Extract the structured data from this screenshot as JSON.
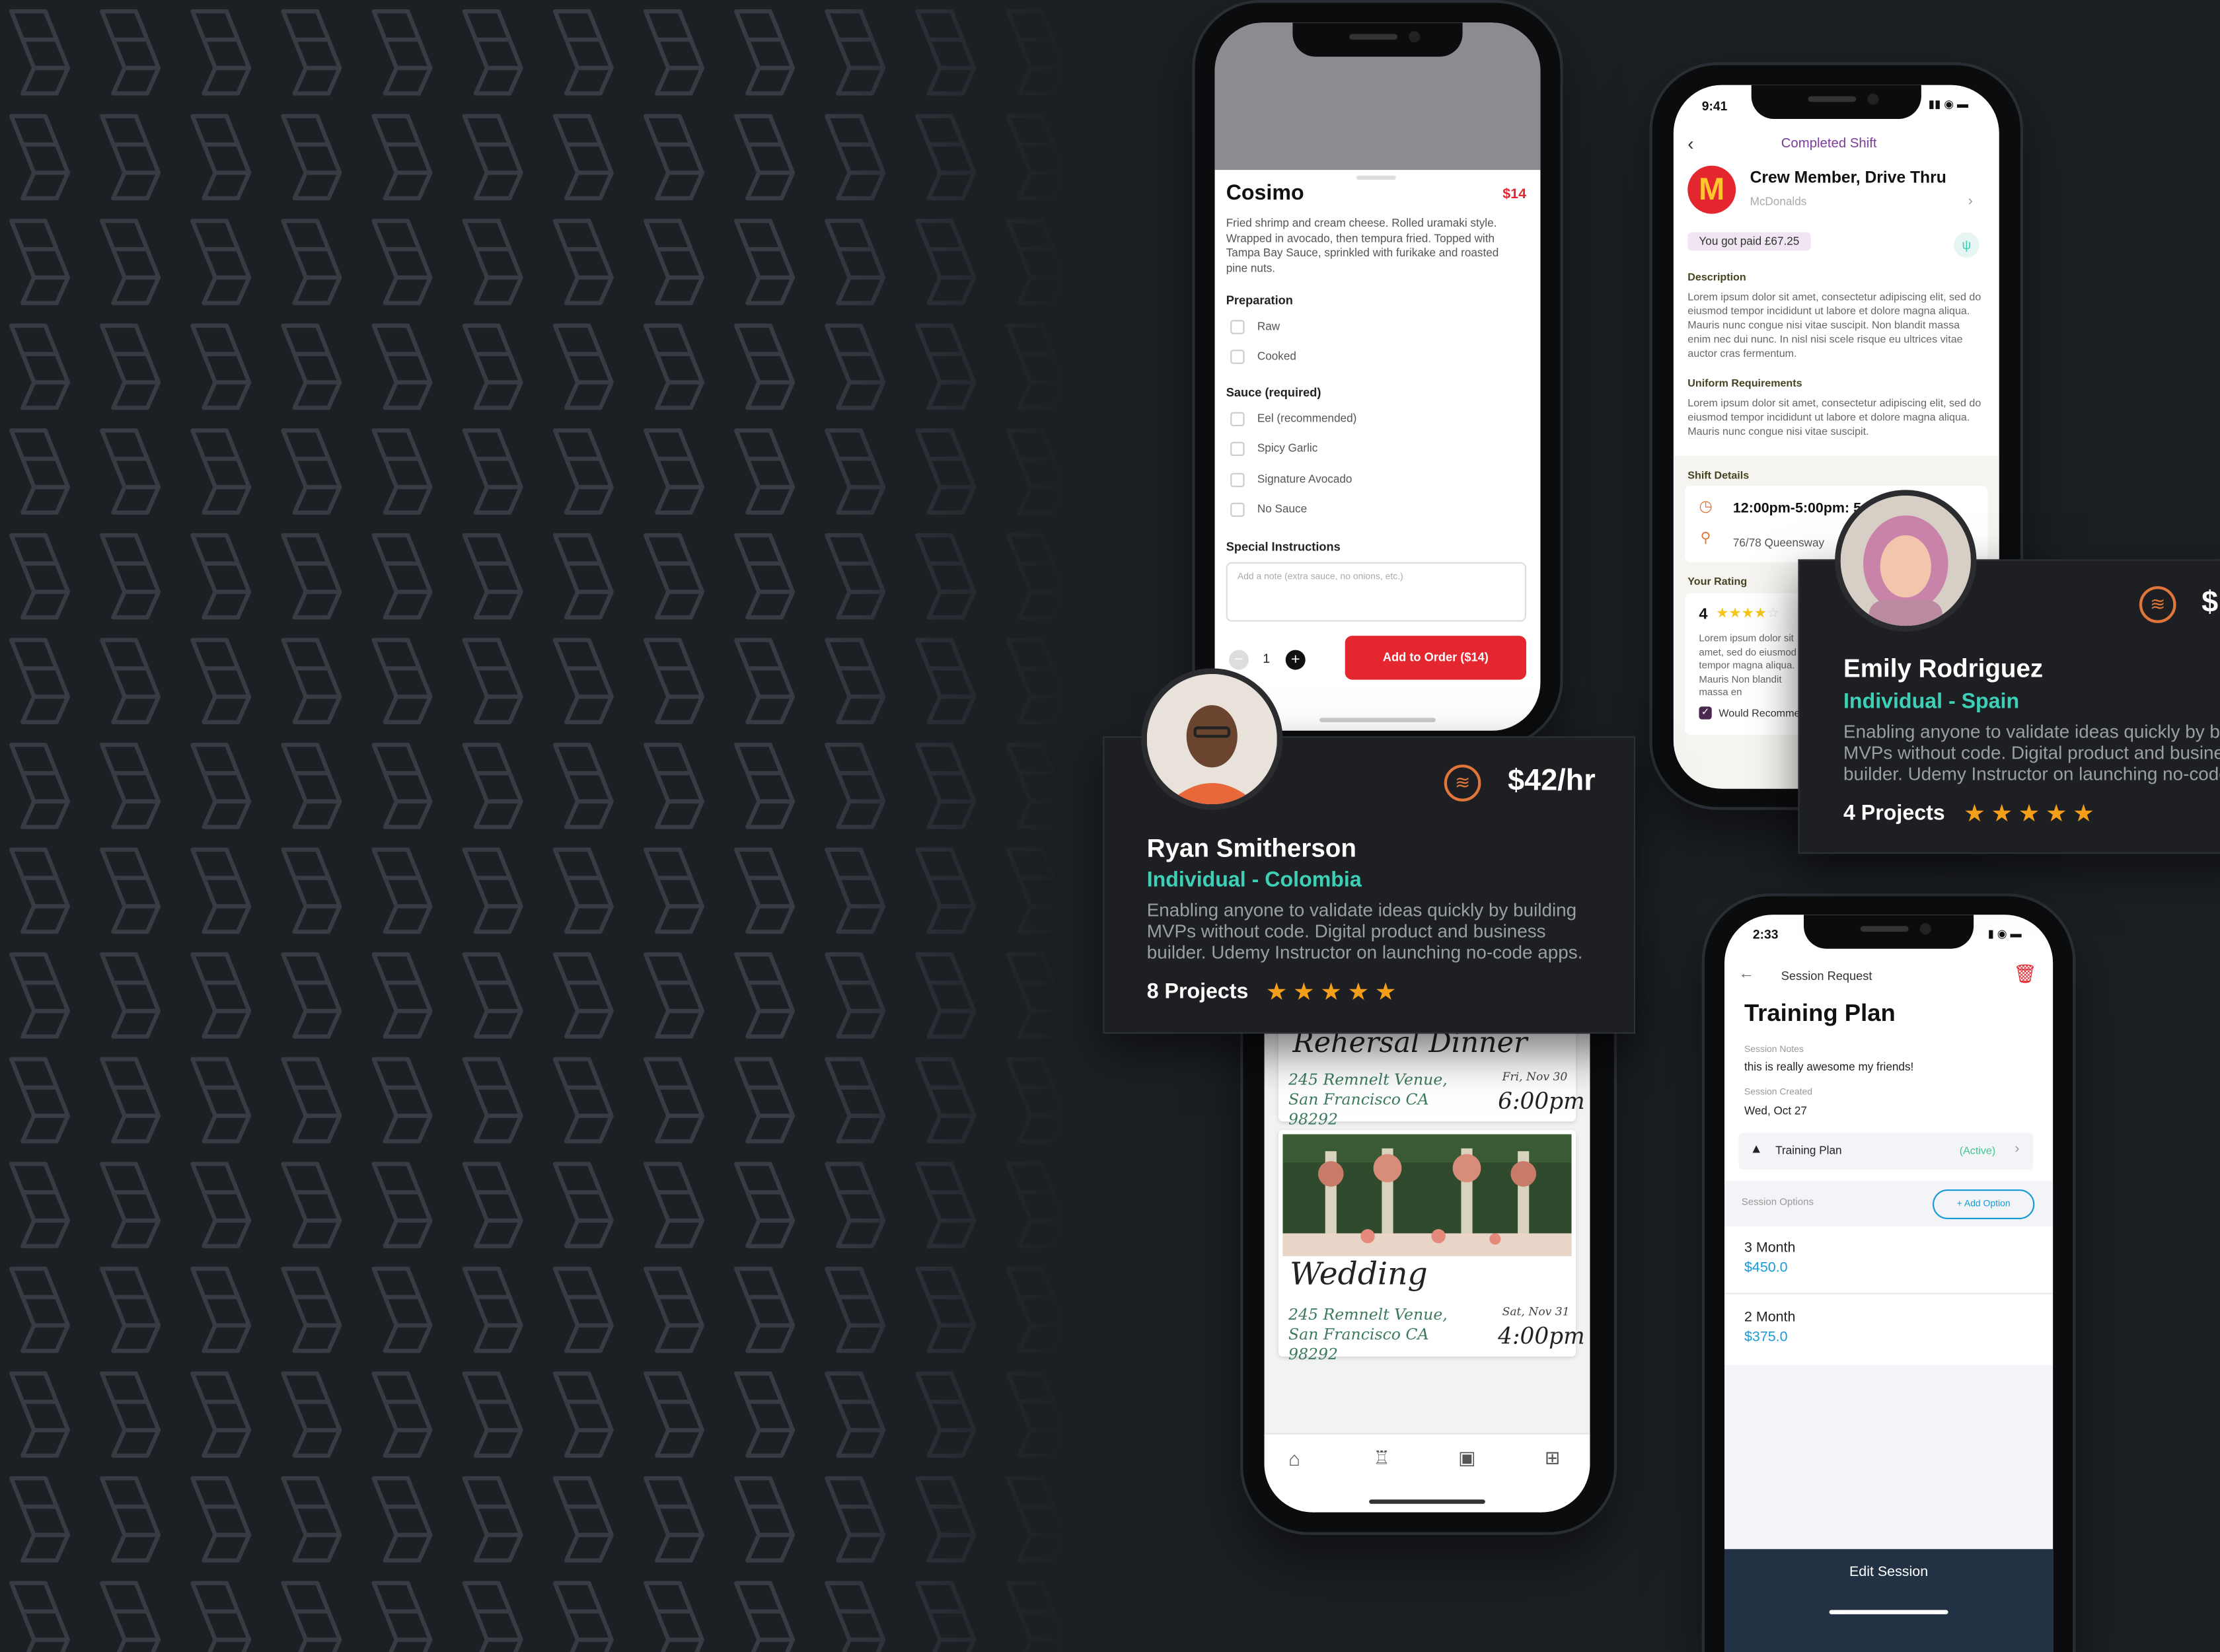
{
  "colors": {
    "background": "#1c1f24",
    "pattern": "#373b42",
    "accent_red": "#e4262f",
    "teal": "#3ecfb7",
    "purple": "#7b3c9c",
    "star": "#f59e1a",
    "navy": "#223244",
    "link_blue": "#1a9ad6"
  },
  "menu_item": {
    "title": "Cosimo",
    "price": "$14",
    "description": "Fried shrimp and cream cheese. Rolled uramaki style. Wrapped in avocado, then tempura fried. Topped with Tampa Bay Sauce, sprinkled with furikake and roasted pine nuts.",
    "preparation_label": "Preparation",
    "preparation_options": [
      "Raw",
      "Cooked"
    ],
    "sauce_label": "Sauce (required)",
    "sauce_options": [
      "Eel (recommended)",
      "Spicy Garlic",
      "Signature Avocado",
      "No Sauce"
    ],
    "special_label": "Special Instructions",
    "special_placeholder": "Add a note (extra sauce, no onions, etc.)",
    "quantity": "1",
    "add_button": "Add to Order ($14)"
  },
  "shift": {
    "time": "9:41",
    "header": "Completed Shift",
    "role": "Crew Member, Drive Thru",
    "company": "McDonalds",
    "paid": "You got paid £67.25",
    "desc_label": "Description",
    "desc_text": "Lorem ipsum dolor sit amet, consectetur adipiscing elit, sed do eiusmod tempor incididunt ut labore et dolore magna aliqua. Mauris nunc congue nisi vitae suscipit. Non blandit massa enim nec dui nunc. In nisl nisi scele risque eu ultrices vitae auctor cras fermentum.",
    "uniform_label": "Uniform Requirements",
    "uniform_text": "Lorem ipsum dolor sit amet, consectetur adipiscing elit, sed do eiusmod tempor incididunt ut labore et dolore magna aliqua. Mauris nunc congue nisi vitae suscipit.",
    "details_label": "Shift Details",
    "hours": "12:00pm-5:00pm: 5",
    "address": "76/78 Queensway",
    "rating_label": "Your Rating",
    "rating": "4",
    "rating_stars": 4,
    "review": "Lorem ipsum dolor sit amet, sed do eiusmod tempor magna aliqua. Mauris Non blandit massa en",
    "recommend": "Would Recommend"
  },
  "events": {
    "items": [
      {
        "title": "Rehersal Dinner",
        "address": "245 Remnelt Venue, San Francisco CA 98292",
        "date": "Fri, Nov 30",
        "time": "6:00pm"
      },
      {
        "title": "Wedding",
        "address": "245 Remnelt Venue, San Francisco CA 98292",
        "date": "Sat, Nov 31",
        "time": "4:00pm"
      }
    ],
    "nav": [
      "home-icon",
      "toast-icon",
      "calendar-icon",
      "grid-icon"
    ]
  },
  "session": {
    "time": "2:33",
    "header": "Session Request",
    "title": "Training Plan",
    "notes_label": "Session Notes",
    "notes": "this is really awesome my friends!",
    "created_label": "Session Created",
    "created": "Wed, Oct 27",
    "plan_name": "Training Plan",
    "plan_status": "(Active)",
    "options_label": "Session Options",
    "add_option": "+ Add Option",
    "options": [
      {
        "name": "3 Month",
        "price": "$450.0"
      },
      {
        "name": "2 Month",
        "price": "$375.0"
      }
    ],
    "footer_button": "Edit Session"
  },
  "profiles": [
    {
      "name": "Ryan Smitherson",
      "subtitle": "Individual - Colombia",
      "rate": "$42/hr",
      "bio": "Enabling anyone to validate ideas quickly by building MVPs without code. Digital product and business builder. Udemy Instructor on launching no-code apps.",
      "projects": "8 Projects",
      "stars": 5
    },
    {
      "name": "Emily Rodriguez",
      "subtitle": "Individual - Spain",
      "rate": "$",
      "bio": "Enabling anyone to validate ideas quickly by building MVPs without code. Digital product and business builder. Udemy Instructor on launching no-code apps.",
      "projects": "4 Projects",
      "stars": 5
    }
  ]
}
